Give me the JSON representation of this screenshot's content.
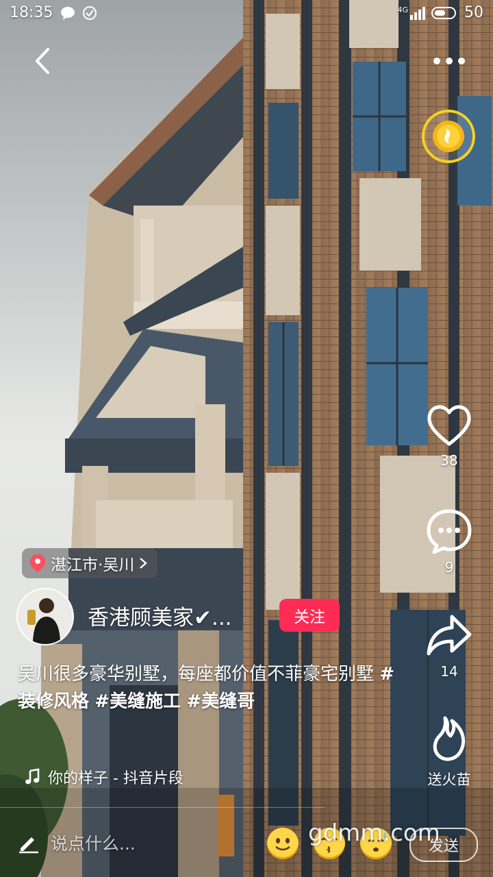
{
  "status_bar": {
    "time": "18:35",
    "network": "4G",
    "battery": "50"
  },
  "header": {
    "back_icon": "chevron-left-icon",
    "more_icon": "more-dots-icon",
    "coin_icon": "gold-coin-icon"
  },
  "actions": {
    "like_count": "38",
    "comment_count": "9",
    "share_count": "14",
    "fire_label": "送火苗"
  },
  "location": {
    "label": "湛江市·吴川"
  },
  "author": {
    "name": "香港顾美家✔...",
    "follow_label": "关注"
  },
  "caption": {
    "text": "吴川很多豪华别墅，每座都价值不菲豪宅别墅",
    "tags": [
      "#装修风格",
      "#美缝施工",
      "#美缝哥"
    ]
  },
  "music": {
    "title": "你的样子 - 抖音片段"
  },
  "comment_input": {
    "placeholder": "说点什么...",
    "send_label": "发送"
  },
  "watermark": "gdmm.com",
  "colors": {
    "accent": "#fe2c55",
    "coin_ring": "#f5d21e"
  }
}
